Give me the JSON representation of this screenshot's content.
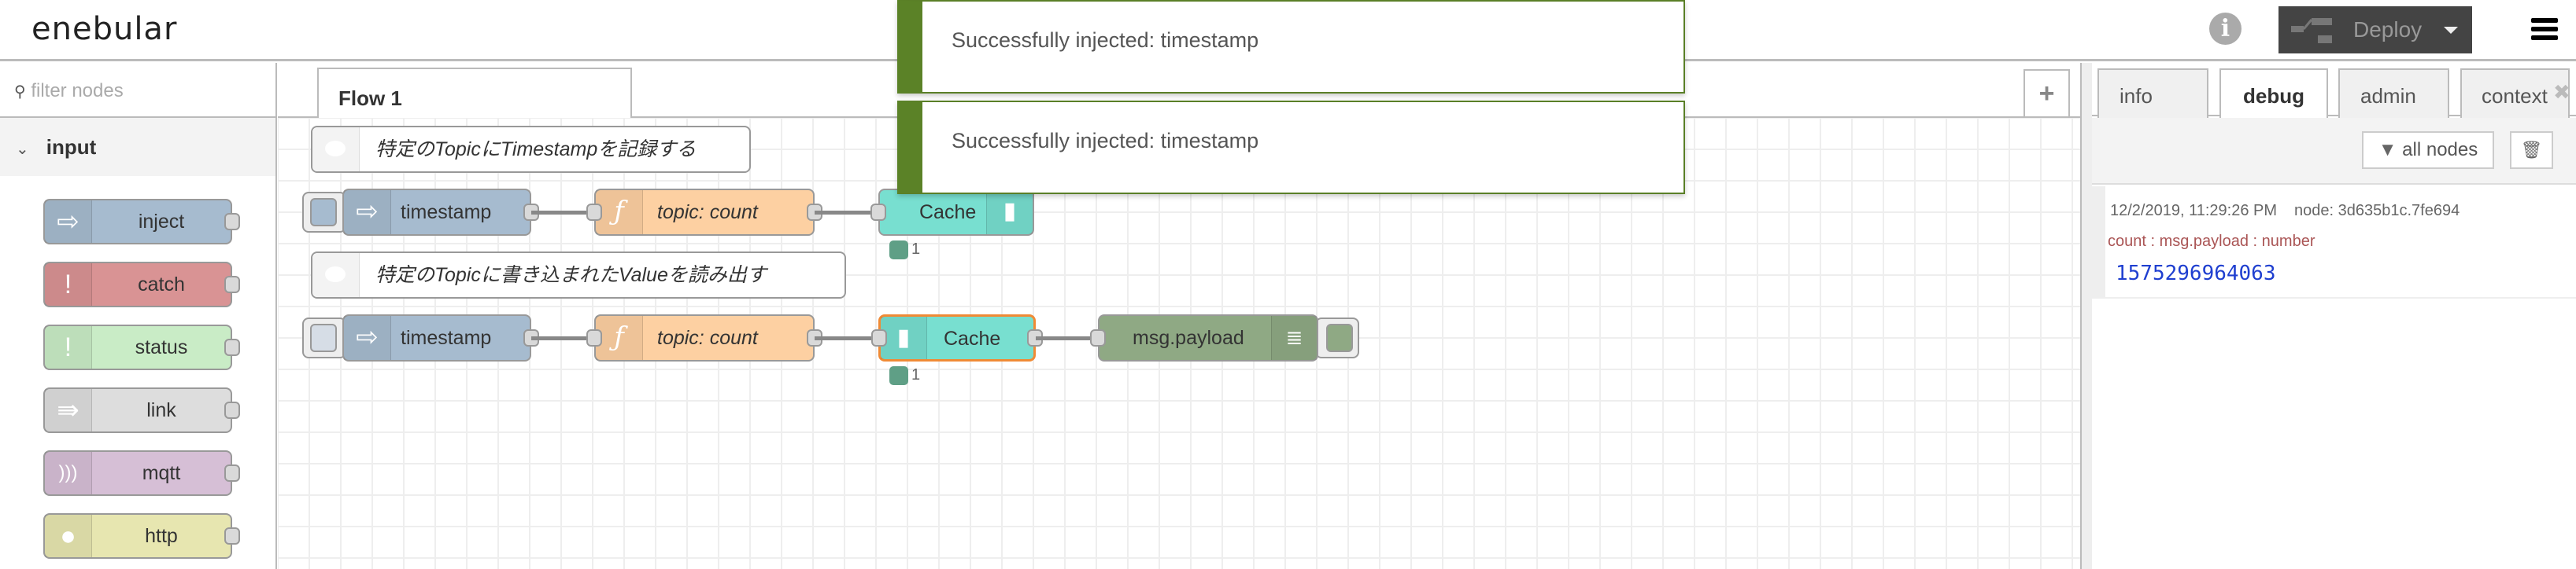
{
  "header": {
    "logo": "enebular",
    "deploy_label": "Deploy"
  },
  "palette": {
    "filter_placeholder": "filter nodes",
    "category": "input",
    "nodes": [
      {
        "label": "inject",
        "color": "#a6bbcf"
      },
      {
        "label": "catch",
        "color": "#d99394"
      },
      {
        "label": "status",
        "color": "#c9ecc6"
      },
      {
        "label": "link",
        "color": "#dddddd"
      },
      {
        "label": "mqtt",
        "color": "#d6bfd6"
      },
      {
        "label": "http",
        "color": "#e7e6b0"
      }
    ]
  },
  "workspace": {
    "tab": "Flow 1",
    "add_tab": "+",
    "comments": [
      "特定のTopicにTimestampを記録する",
      "特定のTopicに書き込まれたValueを読み出す"
    ],
    "flow1": {
      "inject": "timestamp",
      "function": "topic: count",
      "cache": "Cache",
      "cache_status": "1"
    },
    "flow2": {
      "inject": "timestamp",
      "function": "topic: count",
      "cache": "Cache",
      "cache_status": "1",
      "debug": "msg.payload"
    }
  },
  "notifications": [
    "Successfully injected: timestamp",
    "Successfully injected: timestamp"
  ],
  "sidebar": {
    "tabs": [
      "info",
      "debug",
      "admin",
      "context"
    ],
    "active_tab": "debug",
    "filter_label": "all nodes",
    "message": {
      "timestamp": "12/2/2019, 11:29:26 PM",
      "node": "node: 3d635b1c.7fe694",
      "path": "count : msg.payload : number",
      "value": "1575296964063"
    }
  }
}
